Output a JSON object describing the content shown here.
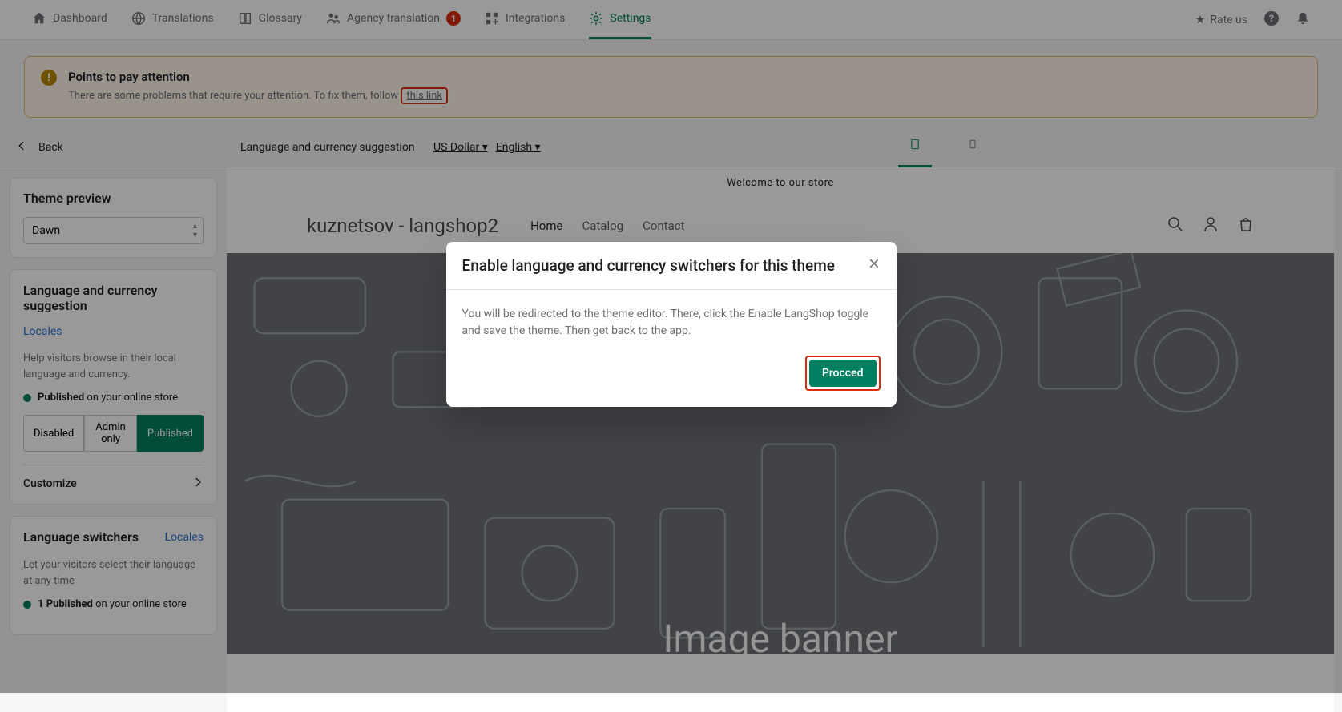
{
  "nav": {
    "dashboard": "Dashboard",
    "translations": "Translations",
    "glossary": "Glossary",
    "agency": "Agency translation",
    "agency_badge": "1",
    "integrations": "Integrations",
    "settings": "Settings",
    "rate_us": "Rate us"
  },
  "banner": {
    "title": "Points to pay attention",
    "text": "There are some problems that require your attention. To fix them, follow ",
    "link": "this link"
  },
  "subheader": {
    "back": "Back",
    "label": "Language and currency suggestion",
    "currency": "US Dollar",
    "language": "English"
  },
  "sidebar": {
    "theme_preview": "Theme preview",
    "theme_value": "Dawn",
    "lang_curr_title": "Language and currency suggestion",
    "locales": "Locales",
    "help1": "Help visitors browse in their local language and currency.",
    "published_bold": "Published",
    "published_rest": " on your online store",
    "disabled": "Disabled",
    "admin_only": "Admin only",
    "published_btn": "Published",
    "customize": "Customize",
    "switchers_title": "Language switchers",
    "switchers_locales": "Locales",
    "switchers_help": "Let your visitors select their language at any time",
    "switchers_status_bold": "1 Published",
    "switchers_status_rest": " on your online store"
  },
  "preview": {
    "announce": "Welcome to our store",
    "store_name": "kuznetsov - langshop2",
    "nav_home": "Home",
    "nav_catalog": "Catalog",
    "nav_contact": "Contact",
    "hero_text": "Image banner"
  },
  "modal": {
    "title": "Enable language and currency switchers for this theme",
    "body": "You will be redirected to the theme editor. There, click the Enable LangShop toggle and save the theme. Then get back to the app.",
    "proceed": "Procced"
  }
}
